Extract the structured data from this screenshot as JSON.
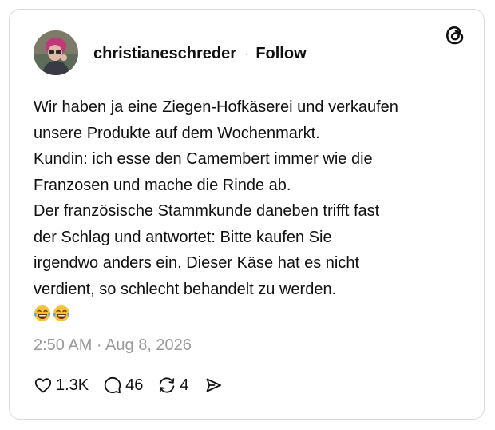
{
  "post": {
    "author": {
      "username": "christianeschreder",
      "separator": "·",
      "follow_label": "Follow"
    },
    "text_lines": [
      "Wir haben ja eine Ziegen-Hofkäserei und verkaufen",
      "unsere Produkte auf dem Wochenmarkt.",
      "Kundin: ich esse den Camembert immer wie die",
      "Franzosen und mache die Rinde ab.",
      "Der französische Stammkunde daneben trifft fast",
      "der Schlag und antwortet: Bitte kaufen Sie",
      "irgendwo anders ein. Dieser Käse hat es nicht",
      "verdient, so schlecht behandelt zu werden."
    ],
    "emojis": [
      "😂",
      "😂"
    ],
    "timestamp": "2:50 AM · Aug 8, 2026",
    "actions": {
      "likes": "1.3K",
      "replies": "46",
      "reposts": "4"
    },
    "icons": {
      "brand_logo": "threads-logo-icon",
      "like": "heart-icon",
      "reply": "comment-icon",
      "repost": "repost-icon",
      "share": "share-icon"
    }
  }
}
